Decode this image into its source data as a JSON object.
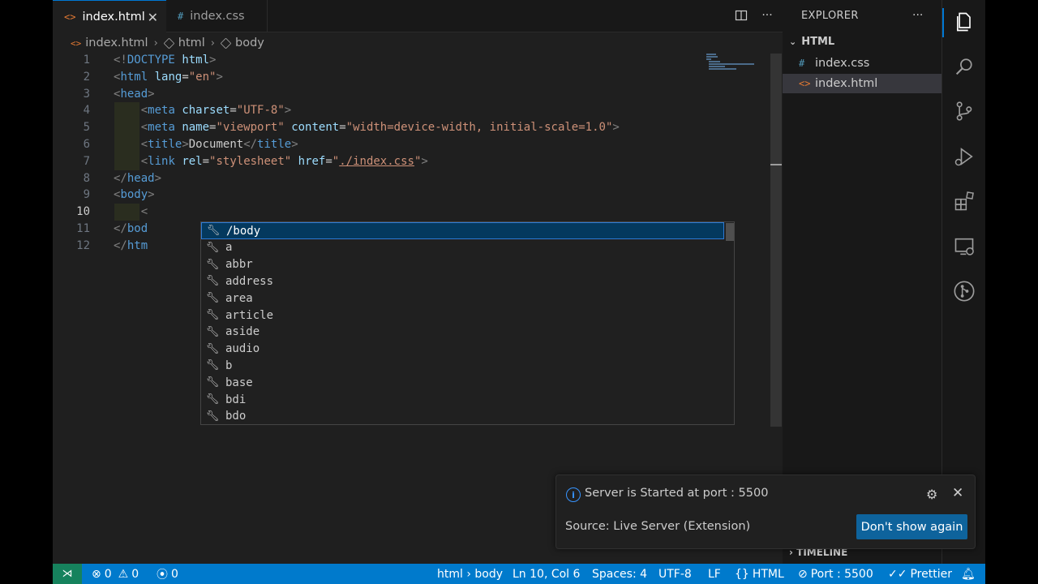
{
  "tabs": [
    {
      "icon": "<>",
      "label": "index.html",
      "active": true
    },
    {
      "icon": "#",
      "label": "index.css",
      "active": false
    }
  ],
  "breadcrumb": [
    "index.html",
    "html",
    "body"
  ],
  "code": {
    "current_line": 10,
    "lines": [
      {
        "n": "1",
        "text": "<!DOCTYPE html>"
      },
      {
        "n": "2",
        "text": "<html lang=\"en\">"
      },
      {
        "n": "3",
        "text": "<head>"
      },
      {
        "n": "4",
        "text": "    <meta charset=\"UTF-8\">"
      },
      {
        "n": "5",
        "text": "    <meta name=\"viewport\" content=\"width=device-width, initial-scale=1.0\">"
      },
      {
        "n": "6",
        "text": "    <title>Document</title>"
      },
      {
        "n": "7",
        "text": "    <link rel=\"stylesheet\" href=\"./index.css\">"
      },
      {
        "n": "8",
        "text": "</head>"
      },
      {
        "n": "9",
        "text": "<body>"
      },
      {
        "n": "10",
        "text": "    <"
      },
      {
        "n": "11",
        "text": "</bod"
      },
      {
        "n": "12",
        "text": "</htm"
      }
    ]
  },
  "suggest": {
    "selected_index": 0,
    "items": [
      "/body",
      "a",
      "abbr",
      "address",
      "area",
      "article",
      "aside",
      "audio",
      "b",
      "base",
      "bdi",
      "bdo"
    ]
  },
  "sidebar": {
    "title": "EXPLORER",
    "more": "···",
    "section": "HTML",
    "files": [
      {
        "icon": "#",
        "name": "index.css",
        "active": false
      },
      {
        "icon": "<>",
        "name": "index.html",
        "active": true
      }
    ],
    "timeline": "TIMELINE"
  },
  "notification": {
    "message": "Server is Started at port : 5500",
    "source": "Source: Live Server (Extension)",
    "button": "Don't show again"
  },
  "statusbar": {
    "errors": "0",
    "warnings": "0",
    "ports": "0",
    "breadcrumb": "html › body",
    "position": "Ln 10, Col 6",
    "spaces": "Spaces: 4",
    "encoding": "UTF-8",
    "eol": "LF",
    "language": "HTML",
    "port": "Port : 5500",
    "formatter": "Prettier"
  },
  "colors": {
    "accent": "#007acc",
    "selection": "#04395e",
    "button": "#0e639c"
  }
}
